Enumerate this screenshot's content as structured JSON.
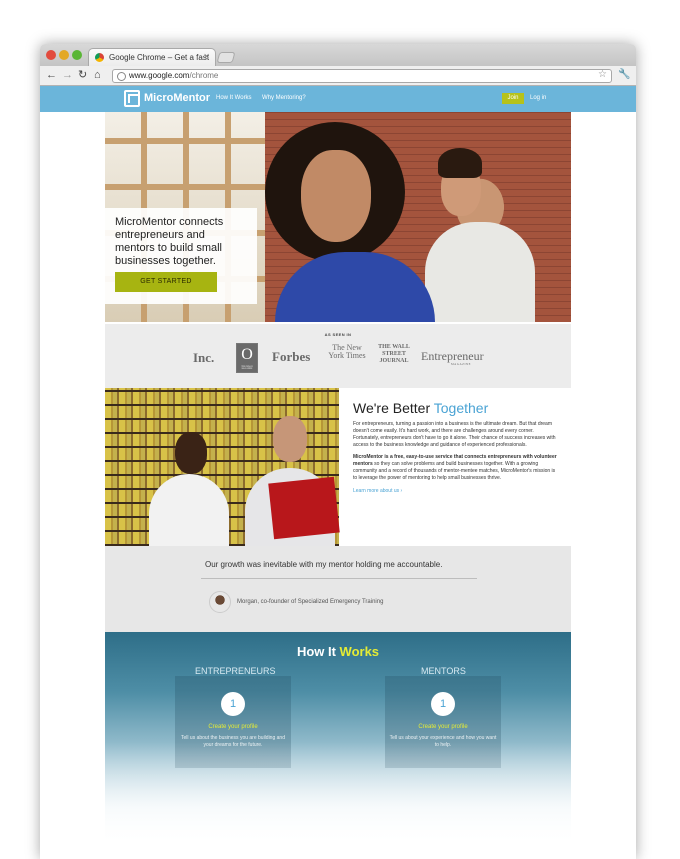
{
  "browser": {
    "tab_title": "Google Chrome – Get a fast",
    "tab_close": "✕",
    "url_domain": "www.google.com",
    "url_path": "/chrome",
    "icons": [
      "back-icon",
      "forward-icon",
      "reload-icon",
      "home-icon",
      "star-icon",
      "wrench-icon",
      "globe-icon"
    ]
  },
  "header": {
    "logo_text": "MicroMentor",
    "nav": [
      "How It Works",
      "Why Mentoring?"
    ],
    "join_label": "Join",
    "login_label": "Log in",
    "brand_color": "#6bb5da",
    "accent_color": "#a7b411"
  },
  "hero": {
    "title": "MicroMentor connects entrepreneurs and mentors to build small businesses together.",
    "cta_label": "GET STARTED"
  },
  "press": {
    "label": "AS SEEN IN",
    "logos": [
      "Inc.",
      "O",
      "Forbes",
      "The New York Times",
      "THE WALL STREET JOURNAL",
      "Entrepreneur"
    ],
    "o_sub": "THE OPRAH MAGAZINE",
    "ent_sub": "MAGAZINE"
  },
  "about": {
    "title_part1": "We're Better ",
    "title_part2": "Together",
    "p1": "For entrepreneurs, turning a passion into a business is the ultimate dream. But that dream doesn't come easily. It's hard work, and there are challenges around every corner. Fortunately, entrepreneurs don't have to go it alone. Their chance of success increases with access to the business knowledge and guidance of experienced professionals.",
    "p2_bold": "MicroMentor is a free, easy-to-use service that connects entrepreneurs with volunteer mentors",
    "p2_rest": " so they can solve problems and build businesses together. With a growing community and a record of thousands of mentor-mentee matches, MicroMentor's mission is to leverage the power of mentoring to help small businesses thrive.",
    "link": "Learn more about us ›"
  },
  "quote": {
    "text": "Our growth was inevitable with my mentor holding me accountable.",
    "author": "Morgan, co-founder of Specialized Emergency Training"
  },
  "how": {
    "title_part1": "How It ",
    "title_part2": "Works",
    "columns": [
      {
        "label": "ENTREPRENEURS",
        "step": "1",
        "step_title": "Create your profile",
        "step_desc": "Tell us about the business you are building and your dreams for the future."
      },
      {
        "label": "MENTORS",
        "step": "1",
        "step_title": "Create your profile",
        "step_desc": "Tell us about your experience and how you want to help."
      }
    ]
  }
}
